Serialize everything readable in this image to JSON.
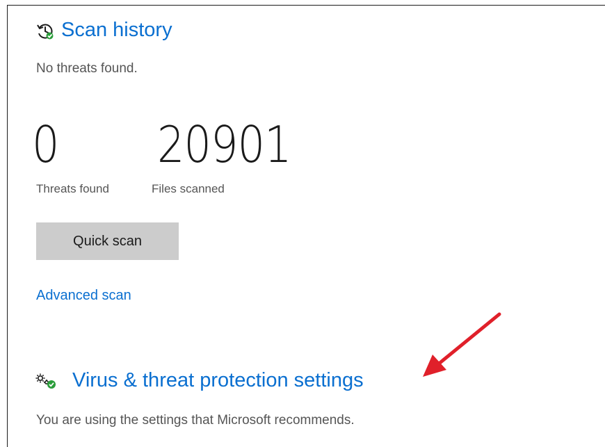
{
  "scan_history": {
    "title": "Scan history",
    "status": "No threats found.",
    "icon": "history-icon"
  },
  "stats": {
    "threats_found_value": "0",
    "threats_found_label": "Threats found",
    "files_scanned_value": "20901",
    "files_scanned_label": "Files scanned"
  },
  "actions": {
    "quick_scan_label": "Quick scan",
    "advanced_scan_label": "Advanced scan"
  },
  "settings": {
    "title": "Virus & threat protection settings",
    "status": "You are using the settings that Microsoft recommends.",
    "icon": "gear-icon"
  },
  "colors": {
    "link_blue": "#0a6fd0",
    "button_gray": "#cccccc",
    "status_green": "#2a9d3a",
    "annotation_red": "#e0202a"
  }
}
